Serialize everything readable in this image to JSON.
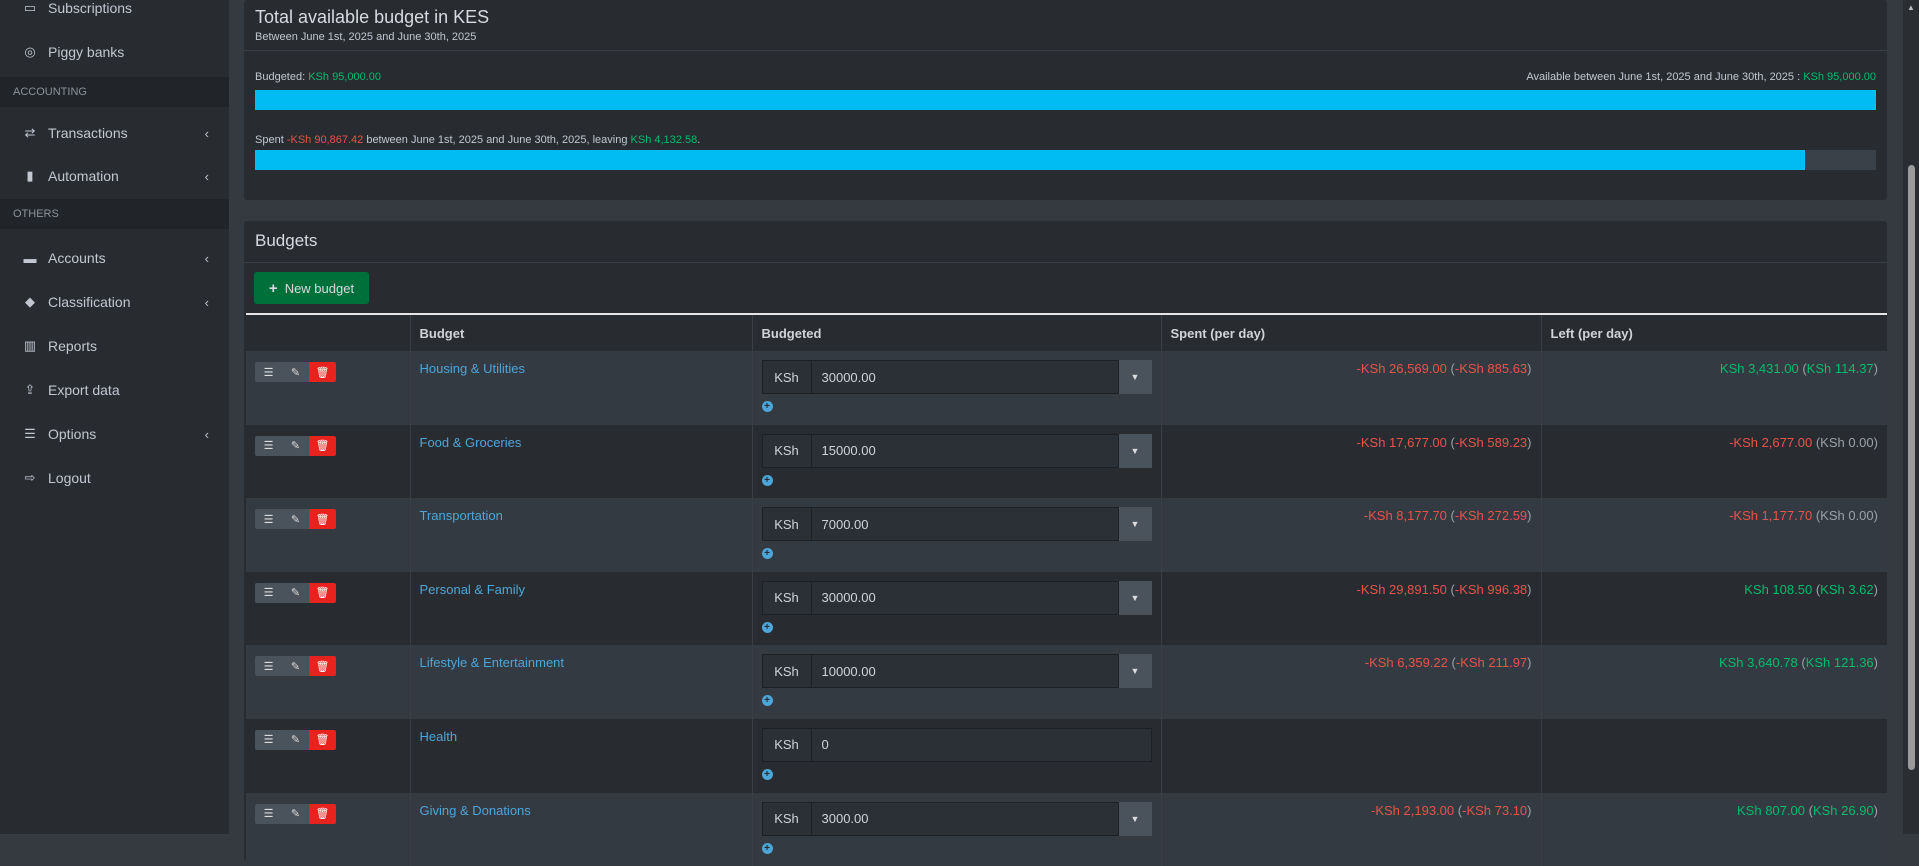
{
  "sidebar": {
    "items_top": [
      {
        "label": "Subscriptions",
        "icon": "calendar-icon"
      },
      {
        "label": "Piggy banks",
        "icon": "target-icon"
      }
    ],
    "section_accounting": "ACCOUNTING",
    "items_accounting": [
      {
        "label": "Transactions",
        "icon": "exchange-icon"
      },
      {
        "label": "Automation",
        "icon": "chip-icon"
      }
    ],
    "section_others": "OTHERS",
    "items_others": [
      {
        "label": "Accounts",
        "icon": "credit-card-icon"
      },
      {
        "label": "Classification",
        "icon": "tags-icon"
      },
      {
        "label": "Reports",
        "icon": "bar-chart-icon"
      },
      {
        "label": "Export data",
        "icon": "upload-icon"
      },
      {
        "label": "Options",
        "icon": "sliders-icon"
      },
      {
        "label": "Logout",
        "icon": "sign-out-icon"
      }
    ]
  },
  "summary": {
    "title": "Total available budget in KES",
    "subtitle": "Between June 1st, 2025 and June 30th, 2025",
    "budgeted_label": "Budgeted: ",
    "budgeted_value": "KSh 95,000.00",
    "available_label": "Available between June 1st, 2025 and June 30th, 2025 : ",
    "available_value": "KSh 95,000.00",
    "budget_bar_fraction": 1.0,
    "spent_label": "Spent ",
    "spent_value": "-KSh 90,867.42",
    "spent_mid": " between June 1st, 2025 and June 30th, 2025, leaving ",
    "leaving_value": "KSh 4,132.58",
    "spent_end": ".",
    "spent_bar_fraction": 0.9565
  },
  "budgets": {
    "title": "Budgets",
    "new_button": "New budget",
    "columns": [
      "",
      "Budget",
      "Budgeted",
      "Spent (per day)",
      "Left (per day)"
    ],
    "rows": [
      {
        "name": "Housing & Utilities",
        "currency": "KSh",
        "amount": "30000.00",
        "spent": "-KSh 26,569.00",
        "spent_day": "-KSh 885.63",
        "left": "KSh 3,431.00",
        "left_day": "KSh 114.37",
        "left_neg": false,
        "left_day_zero": false
      },
      {
        "name": "Food & Groceries",
        "currency": "KSh",
        "amount": "15000.00",
        "spent": "-KSh 17,677.00",
        "spent_day": "-KSh 589.23",
        "left": "-KSh 2,677.00",
        "left_day": "KSh 0.00",
        "left_neg": true,
        "left_day_zero": true
      },
      {
        "name": "Transportation",
        "currency": "KSh",
        "amount": "7000.00",
        "spent": "-KSh 8,177.70",
        "spent_day": "-KSh 272.59",
        "left": "-KSh 1,177.70",
        "left_day": "KSh 0.00",
        "left_neg": true,
        "left_day_zero": true
      },
      {
        "name": "Personal & Family",
        "currency": "KSh",
        "amount": "30000.00",
        "spent": "-KSh 29,891.50",
        "spent_day": "-KSh 996.38",
        "left": "KSh 108.50",
        "left_day": "KSh 3.62",
        "left_neg": false,
        "left_day_zero": false
      },
      {
        "name": "Lifestyle & Entertainment",
        "currency": "KSh",
        "amount": "10000.00",
        "spent": "-KSh 6,359.22",
        "spent_day": "-KSh 211.97",
        "left": "KSh 3,640.78",
        "left_day": "KSh 121.36",
        "left_neg": false,
        "left_day_zero": false
      },
      {
        "name": "Health",
        "currency": "KSh",
        "amount": "0",
        "spent": null,
        "spent_day": null,
        "left": null,
        "left_day": null,
        "no_dropdown": true
      },
      {
        "name": "Giving & Donations",
        "currency": "KSh",
        "amount": "3000.00",
        "spent": "-KSh 2,193.00",
        "spent_day": "-KSh 73.10",
        "left": "KSh 807.00",
        "left_day": "KSh 26.90",
        "left_neg": false,
        "left_day_zero": false
      }
    ]
  },
  "colors": {
    "accent": "#00bcf2",
    "positive": "#00bc6c",
    "negative": "#e8534a",
    "new_button": "#00703a",
    "delete": "#e8221c"
  }
}
